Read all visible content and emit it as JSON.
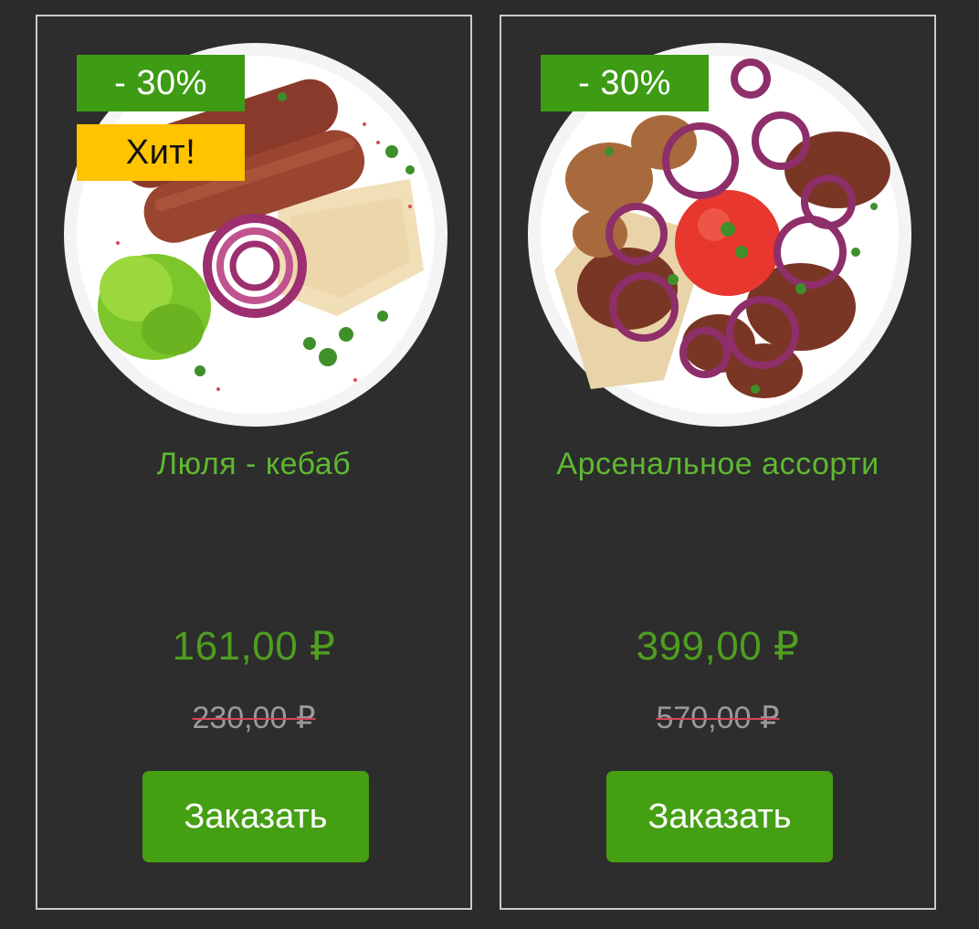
{
  "products": [
    {
      "discount_badge": "- 30%",
      "hit_badge": "Хит!",
      "title": "Люля - кебаб",
      "price": "161,00 ₽",
      "old_price": "230,00 ₽",
      "order_label": "Заказать",
      "image_icon": "lula-kebab-photo"
    },
    {
      "discount_badge": "- 30%",
      "title": "Арсенальное ассорти",
      "price": "399,00 ₽",
      "old_price": "570,00 ₽",
      "order_label": "Заказать",
      "image_icon": "assorted-shashlik-photo"
    }
  ],
  "colors": {
    "background": "#2b2b2b",
    "accent_green": "#44a012",
    "title_green": "#5fb830",
    "hit_yellow": "#ffc300"
  }
}
